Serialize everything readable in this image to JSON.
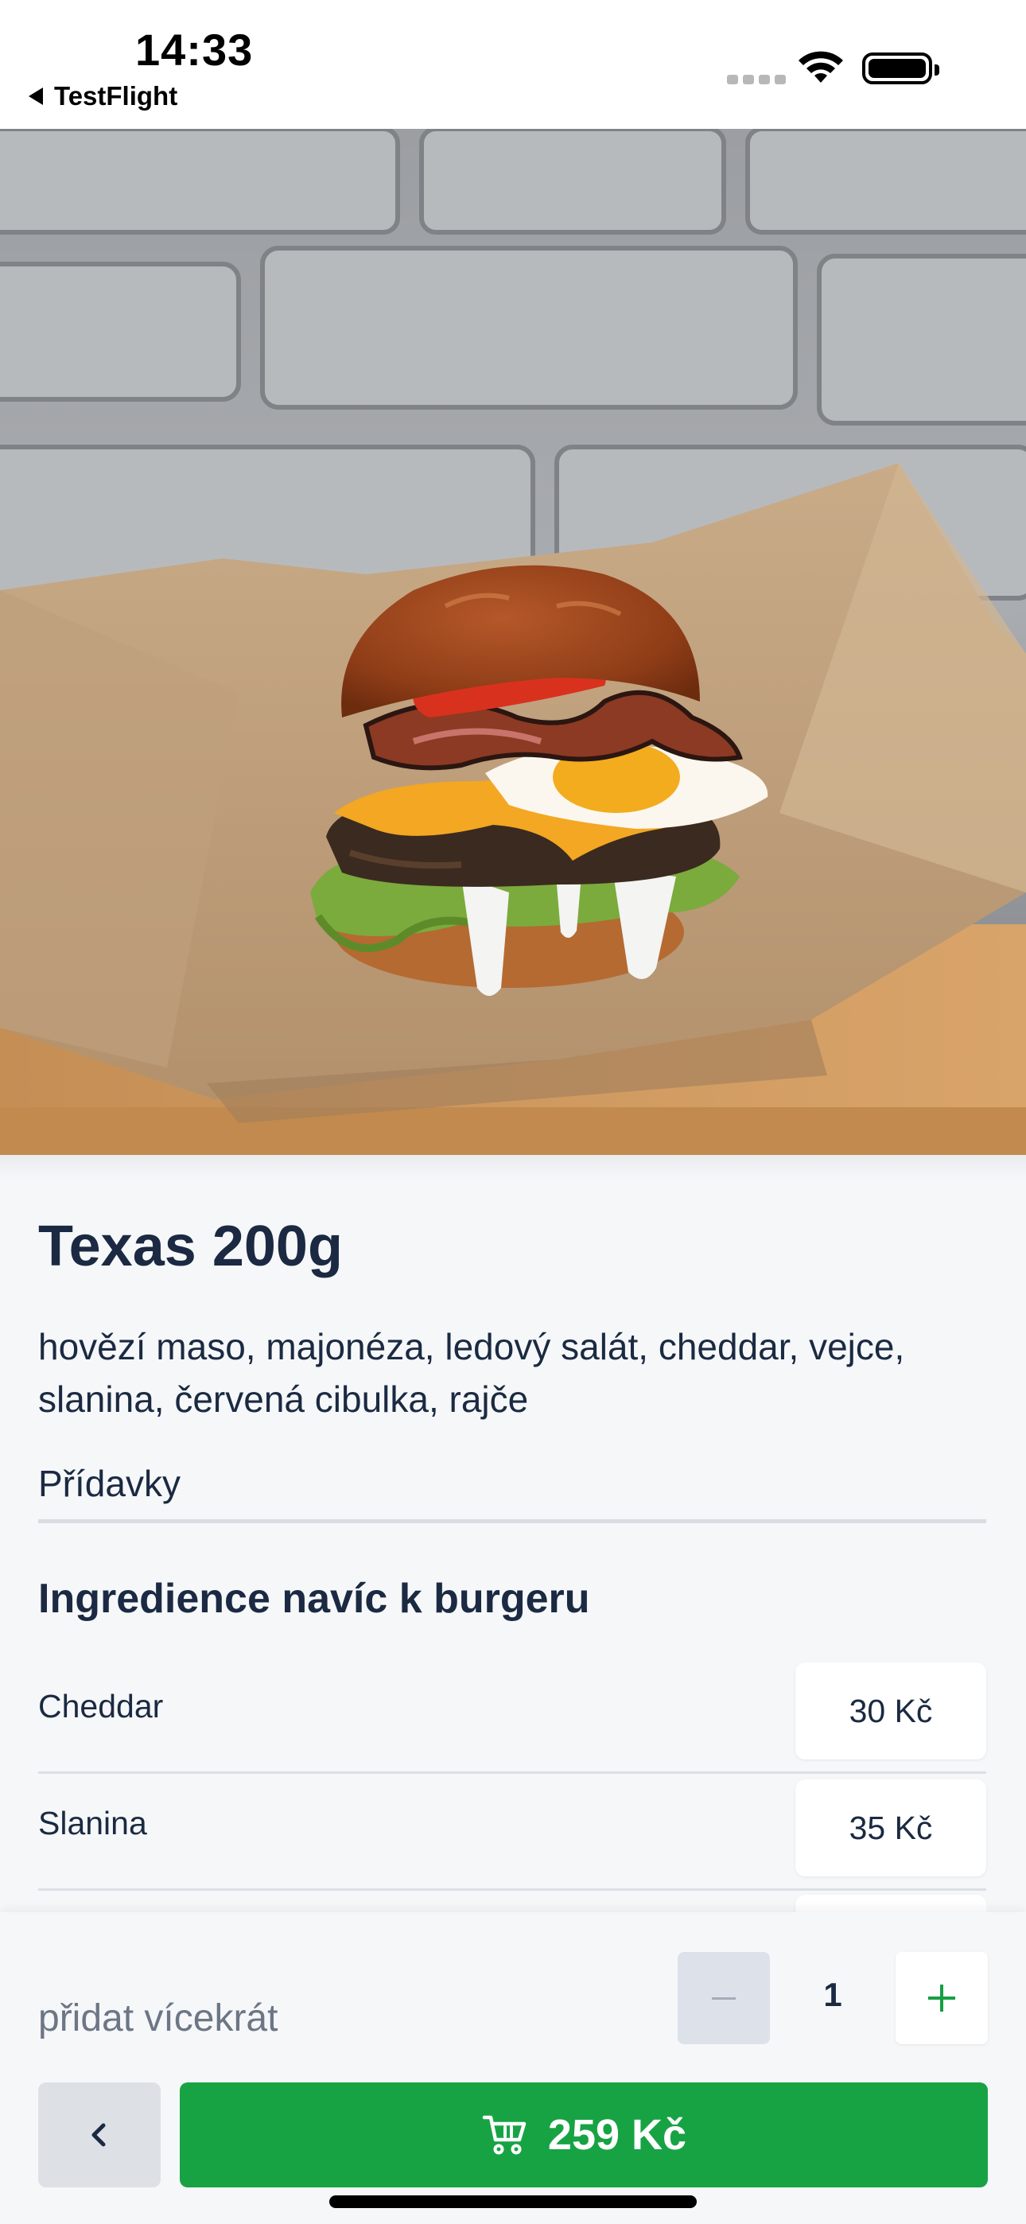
{
  "status_bar": {
    "time": "14:33",
    "back_app_label": "TestFlight"
  },
  "product": {
    "name": "Texas 200g",
    "description": "hovězí maso, majonéza, ledový salát, cheddar, vejce, slanina, červená cibulka, rajče"
  },
  "section_tab": {
    "label": "Přídavky"
  },
  "extras": {
    "heading": "Ingredience navíc k burgeru",
    "items": [
      {
        "name": "Cheddar",
        "price": "30 Kč"
      },
      {
        "name": "Slanina",
        "price": "35 Kč"
      }
    ]
  },
  "bottom_bar": {
    "multiple_label": "přidat vícekrát",
    "quantity": "1",
    "cart_total": "259 Kč"
  },
  "colors": {
    "primary_green": "#17a344",
    "text_dark": "#1b2a42",
    "background": "#f6f7f9"
  },
  "icons": [
    "back-arrow-icon",
    "signal-icon",
    "wifi-icon",
    "battery-icon",
    "minus-icon",
    "plus-icon",
    "chevron-left-icon",
    "cart-icon"
  ]
}
